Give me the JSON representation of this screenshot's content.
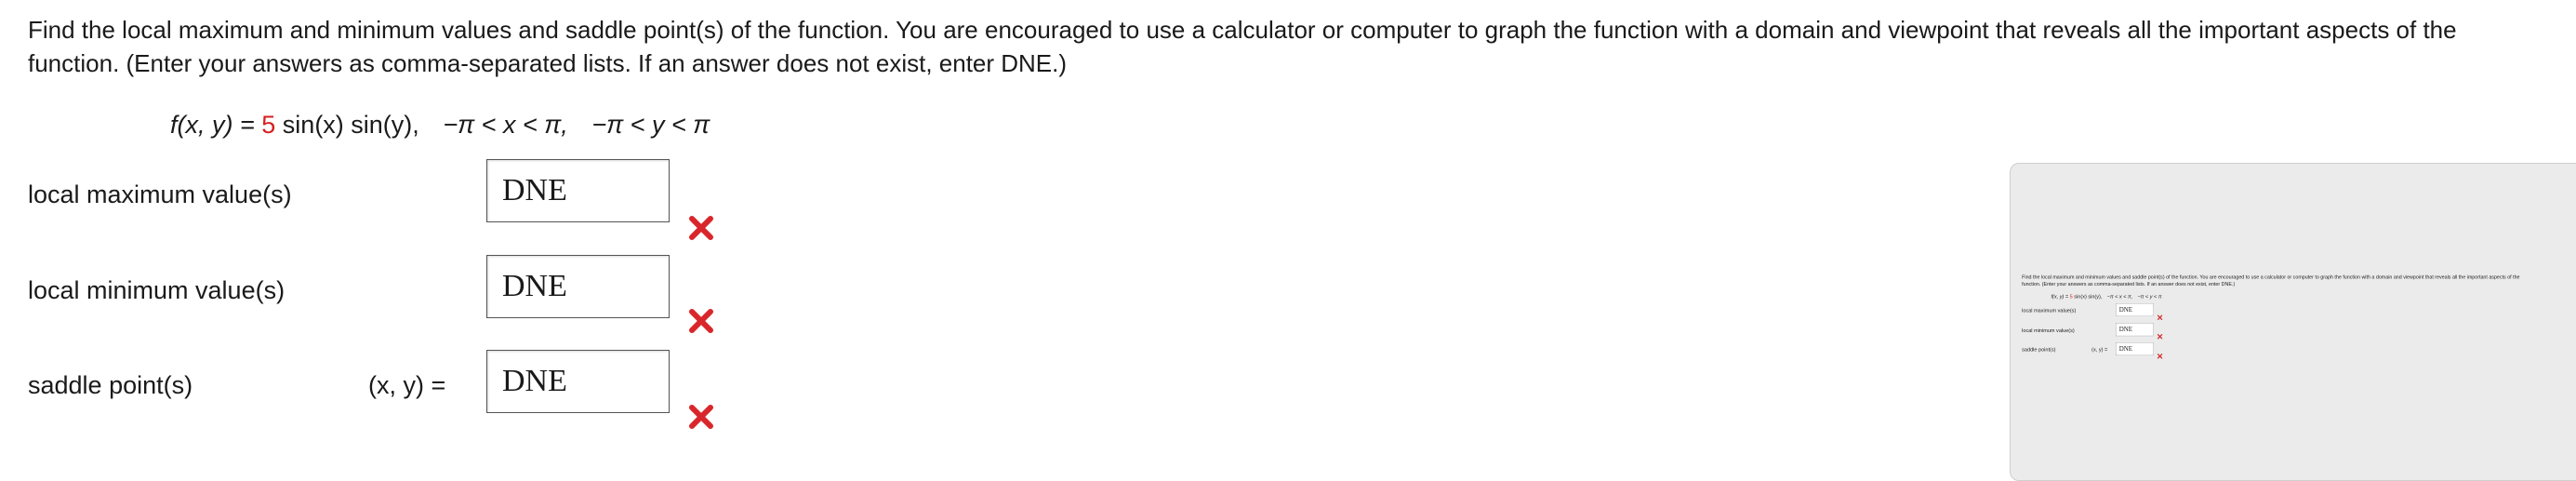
{
  "question": {
    "text": "Find the local maximum and minimum values and saddle point(s) of the function. You are encouraged to use a calculator or computer to graph the function with a domain and viewpoint that reveals all the important aspects of the function. (Enter your answers as comma-separated lists. If an answer does not exist, enter DNE.)"
  },
  "formula": {
    "lhs": "f(x, y) = ",
    "coefficient": "5",
    "rhs": " sin(x) sin(y),",
    "domain_x": "−π < x < π,",
    "domain_y": "−π < y < π"
  },
  "rows": [
    {
      "label": "local maximum value(s)",
      "prefix": "",
      "value": "DNE",
      "status": "incorrect"
    },
    {
      "label": "local minimum value(s)",
      "prefix": "",
      "value": "DNE",
      "status": "incorrect"
    },
    {
      "label": "saddle point(s)",
      "prefix": "(x, y)  = ",
      "value": "DNE",
      "status": "incorrect"
    }
  ],
  "icons": {
    "incorrect": "x-mark-icon"
  },
  "colors": {
    "coefficient": "#d62020",
    "incorrect_mark": "#d9262b",
    "preview_panel": "#ebebeb"
  }
}
